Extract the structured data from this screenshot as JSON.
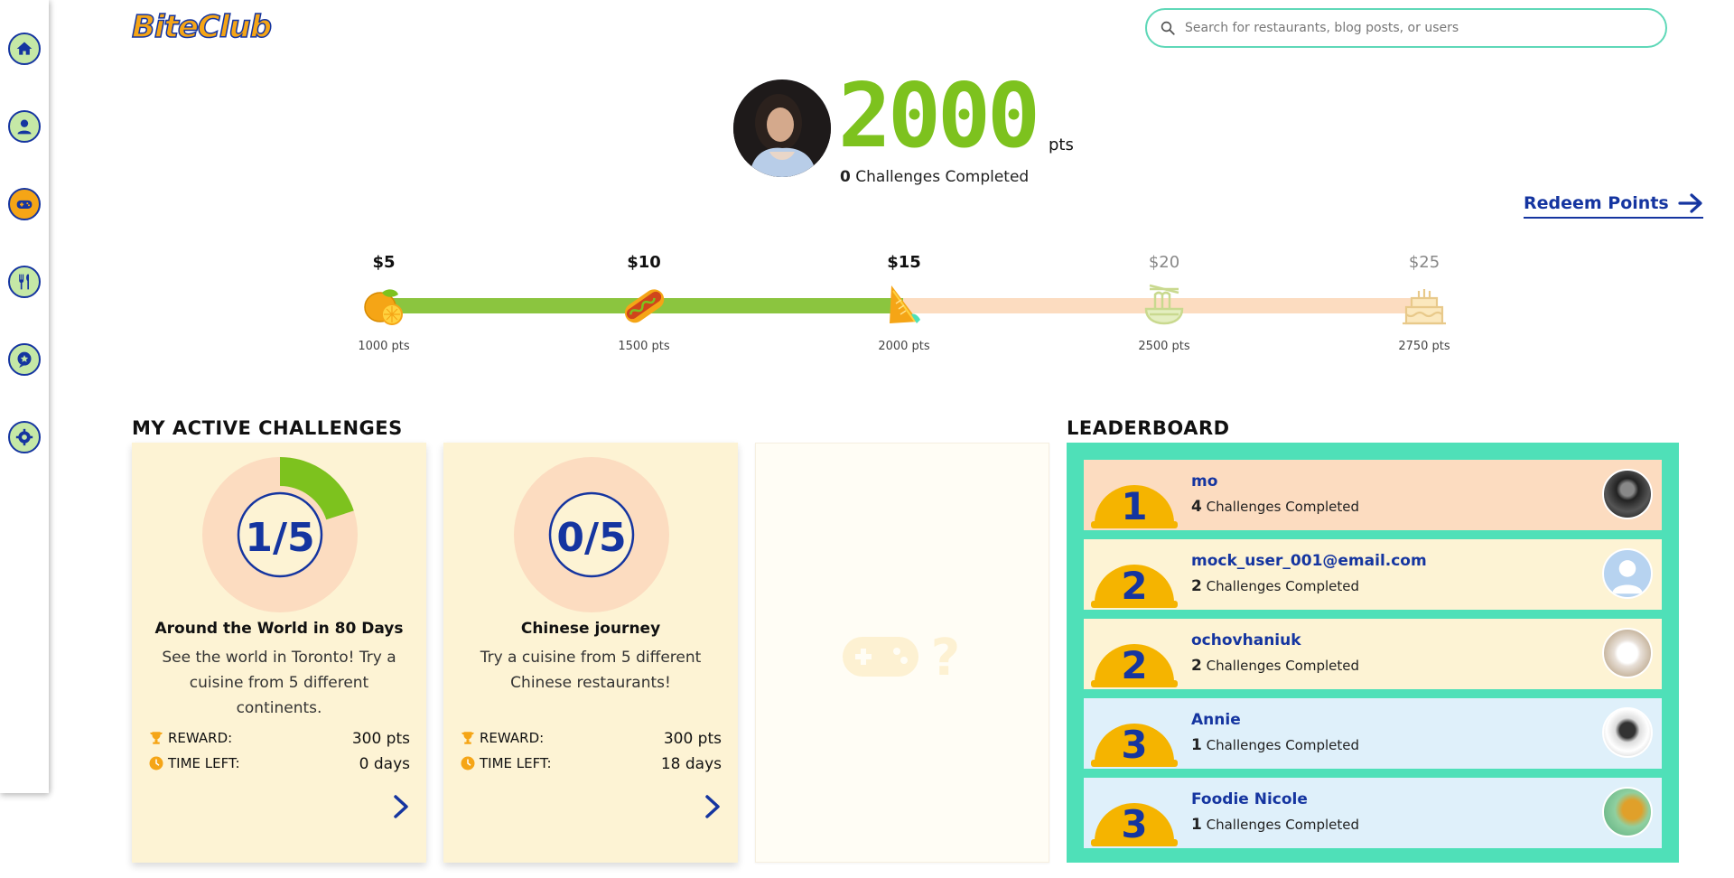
{
  "app": {
    "logo": "BiteClub"
  },
  "search": {
    "placeholder": "Search for restaurants, blog posts, or users"
  },
  "sidebar": {
    "items": [
      {
        "icon": "home-icon",
        "active": false
      },
      {
        "icon": "user-icon",
        "active": false
      },
      {
        "icon": "gamepad-icon",
        "active": true
      },
      {
        "icon": "fork-knife-icon",
        "active": false
      },
      {
        "icon": "blog-icon",
        "active": false
      },
      {
        "icon": "gear-icon",
        "active": false
      }
    ]
  },
  "profile": {
    "points": "2000",
    "points_unit": "pts",
    "challenges_count": "0",
    "challenges_label": "Challenges Completed",
    "redeem_label": "Redeem Points"
  },
  "progress": {
    "current_points": 2000,
    "milestones": [
      {
        "price": "$5",
        "pts": "1000 pts",
        "icon": "lemon-icon",
        "reached": true
      },
      {
        "price": "$10",
        "pts": "1500 pts",
        "icon": "hotdog-icon",
        "reached": true
      },
      {
        "price": "$15",
        "pts": "2000 pts",
        "icon": "sandwich-icon",
        "reached": true
      },
      {
        "price": "$20",
        "pts": "2500 pts",
        "icon": "noodles-icon",
        "reached": false
      },
      {
        "price": "$25",
        "pts": "2750 pts",
        "icon": "cake-icon",
        "reached": false
      }
    ]
  },
  "challenges": {
    "title": "MY ACTIVE CHALLENGES",
    "reward_label": "REWARD:",
    "time_label": "TIME LEFT:",
    "pts_unit": "pts",
    "days_unit": "days",
    "cards": [
      {
        "progress": "1/5",
        "done": 1,
        "total": 5,
        "name": "Around the World in 80 Days",
        "desc": "See the world in Toronto! Try a cuisine from 5 different continents.",
        "reward": "300",
        "time_left": "0"
      },
      {
        "progress": "0/5",
        "done": 0,
        "total": 5,
        "name": "Chinese journey",
        "desc": "Try a cuisine from 5 different Chinese restaurants!",
        "reward": "300",
        "time_left": "18"
      }
    ]
  },
  "leaderboard": {
    "title": "LEADERBOARD",
    "entries": [
      {
        "rank": "1",
        "name": "mo",
        "count": "4",
        "label": "Challenges Completed",
        "bg": "#fcdcc0"
      },
      {
        "rank": "2",
        "name": "mock_user_001@email.com",
        "count": "2",
        "label": "Challenges Completed",
        "bg": "#fdf3d4"
      },
      {
        "rank": "2",
        "name": "ochovhaniuk",
        "count": "2",
        "label": "Challenges Completed",
        "bg": "#fdf3d4"
      },
      {
        "rank": "3",
        "name": "Annie",
        "count": "1",
        "label": "Challenges Completed",
        "bg": "#dff0fa"
      },
      {
        "rank": "3",
        "name": "Foodie Nicole",
        "count": "1",
        "label": "Challenges Completed",
        "bg": "#dff0fa"
      }
    ]
  },
  "colors": {
    "accent_green": "#7dc21e",
    "navy": "#1535a0",
    "orange": "#f5a516",
    "mint": "#4fe0b8"
  }
}
